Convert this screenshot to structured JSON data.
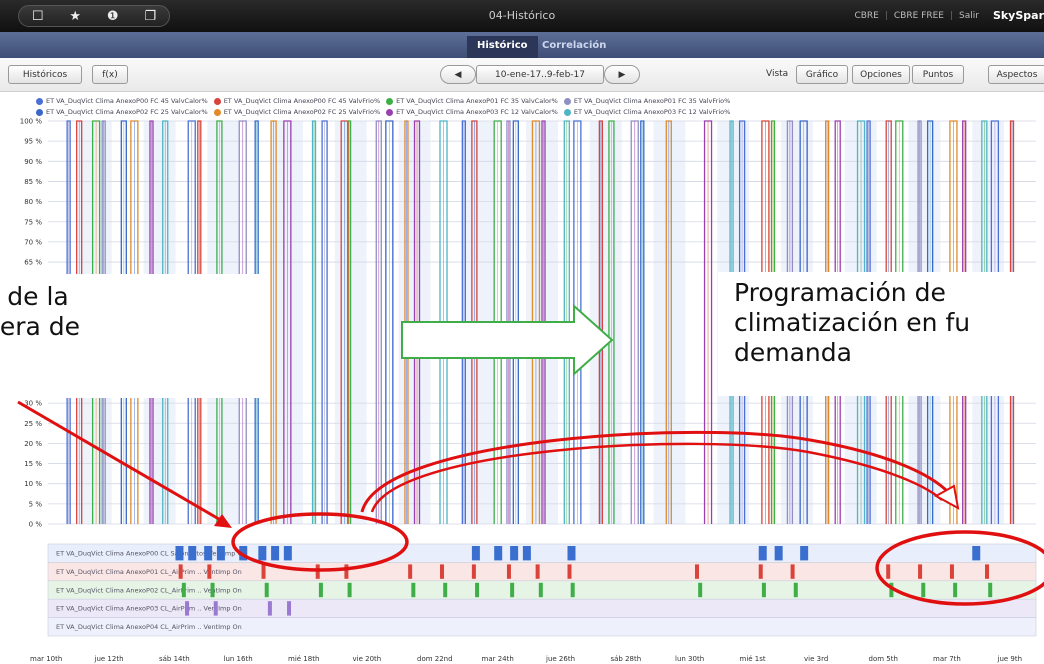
{
  "titlebar": {
    "icons": [
      "square-icon",
      "star-icon",
      "download-icon",
      "windows-icon"
    ],
    "title": "04-Histórico",
    "links": [
      "CBRE",
      "CBRE FREE",
      "Salir"
    ],
    "brand": "SkySpar"
  },
  "tabs": [
    {
      "label": "Histórico",
      "active": true
    },
    {
      "label": "Correlación",
      "active": false
    }
  ],
  "toolbar": {
    "historicos": "Históricos",
    "fx": "f(x)",
    "prev": "◀",
    "date_range": "10-ene-17..9-feb-17",
    "next": "▶",
    "vista_label": "Vista",
    "grafico": "Gráfico",
    "opciones": "Opciones",
    "puntos": "Puntos",
    "aspectos": "Aspectos"
  },
  "legend": {
    "row1": [
      {
        "label": "ET VA_DuqVict Clima AnexoP00 FC 45 ValvCalor%",
        "color": "#4a6fd8"
      },
      {
        "label": "ET VA_DuqVict Clima AnexoP00 FC 45 ValvFrio%",
        "color": "#d9433a"
      },
      {
        "label": "ET VA_DuqVict Clima AnexoP01 FC 35 ValvCalor%",
        "color": "#3fae49"
      },
      {
        "label": "ET VA_DuqVict Clima AnexoP01 FC 35 ValvFrio%",
        "color": "#8f8fc4"
      }
    ],
    "row2": [
      {
        "label": "ET VA_DuqVict Clima AnexoP02 FC 25 ValvCalor%",
        "color": "#3a66c8"
      },
      {
        "label": "ET VA_DuqVict Clima AnexoP02 FC 25 ValvFrio%",
        "color": "#e08a2a"
      },
      {
        "label": "ET VA_DuqVict Clima AnexoP03 FC 12 ValvCalor%",
        "color": "#9a3fb0"
      },
      {
        "label": "ET VA_DuqVict Clima AnexoP03 FC 12 ValvFrio%",
        "color": "#4fb4c8"
      }
    ]
  },
  "chart_data": {
    "type": "line",
    "ylim": [
      0,
      100
    ],
    "y_ticks": [
      "100 %",
      "95 %",
      "90 %",
      "85 %",
      "80 %",
      "75 %",
      "70 %",
      "65 %",
      "30 %",
      "25 %",
      "20 %",
      "15 %",
      "10 %",
      "5 %",
      "0 %"
    ],
    "x_ticks": [
      "mar 10th",
      "jue 12th",
      "sáb 14th",
      "lun 16th",
      "mié 18th",
      "vie 20th",
      "dom 22nd",
      "mar 24th",
      "jue 26th",
      "sáb 28th",
      "lun 30th",
      "mié 1st",
      "vie 3rd",
      "dom 5th",
      "mar 7th",
      "jue 9th"
    ],
    "grid": true,
    "series_colors": [
      "#4a6fd8",
      "#d9433a",
      "#3fae49",
      "#8f8fc4",
      "#3a66c8",
      "#e08a2a",
      "#9a3fb0",
      "#4fb4c8"
    ],
    "pulse_days": [
      0.6,
      0.9,
      1.4,
      1.7,
      2.3,
      2.6,
      3.2,
      3.6,
      4.4,
      4.7,
      5.3,
      6.0,
      6.5,
      7.0,
      7.4,
      8.3,
      8.6,
      9.2,
      9.4,
      10.3,
      10.6,
      11.2,
      11.5,
      12.3,
      13.0,
      13.3,
      14.0,
      14.4,
      14.6,
      15.2,
      15.5,
      16.2,
      16.5,
      17.3,
      17.6,
      18.3,
      18.6,
      19.4,
      20.6,
      21.4,
      21.7,
      22.4,
      22.7,
      23.2,
      23.6,
      24.4,
      24.7,
      25.4,
      25.7,
      26.3,
      26.6,
      27.3,
      27.6,
      28.3,
      28.7,
      29.3,
      29.6,
      30.2
    ],
    "lanes": [
      {
        "label": "ET VA_DuqVict Clima AnexoP00 CL SalonActos VentImp On",
        "color": "#3a6fd0",
        "pulse_days": [
          4.0,
          4.4,
          4.9,
          5.3,
          6.0,
          6.6,
          7.0,
          7.4,
          13.3,
          14.0,
          14.5,
          14.9,
          16.3,
          22.3,
          22.8,
          23.6,
          29.0
        ]
      },
      {
        "label": "ET VA_DuqVict Clima AnexoP01 CL_AirPrim .. VentImp On",
        "color": "#d9433a",
        "pulse_days": [
          4.1,
          5.0,
          6.7,
          8.4,
          9.3,
          11.3,
          12.3,
          13.3,
          14.4,
          15.3,
          16.3,
          20.3,
          22.3,
          23.3,
          26.3,
          27.3,
          28.3,
          29.4
        ]
      },
      {
        "label": "ET VA_DuqVict Clima AnexoP02 CL_AirPrim .. VentImp On",
        "color": "#3fae49",
        "pulse_days": [
          4.2,
          5.1,
          6.8,
          8.5,
          9.4,
          11.4,
          12.4,
          13.4,
          14.5,
          15.4,
          16.4,
          20.4,
          22.4,
          23.4,
          26.4,
          27.4,
          28.4,
          29.5
        ]
      },
      {
        "label": "ET VA_DuqVict Clima AnexoP03 CL_AirPrim .. VentImp On",
        "color": "#9a7ad0",
        "pulse_days": [
          4.3,
          5.2,
          6.9,
          7.5
        ]
      },
      {
        "label": "ET VA_DuqVict Clima AnexoP04 CL_AirPrim .. VentImp On",
        "color": "#7c8fd8",
        "pulse_days": []
      }
    ]
  },
  "annotations": {
    "left_line1": "o de la",
    "left_line2": "uera de",
    "right_line1": "Programación de",
    "right_line2": "climatización en fu",
    "right_line3": "demanda"
  }
}
